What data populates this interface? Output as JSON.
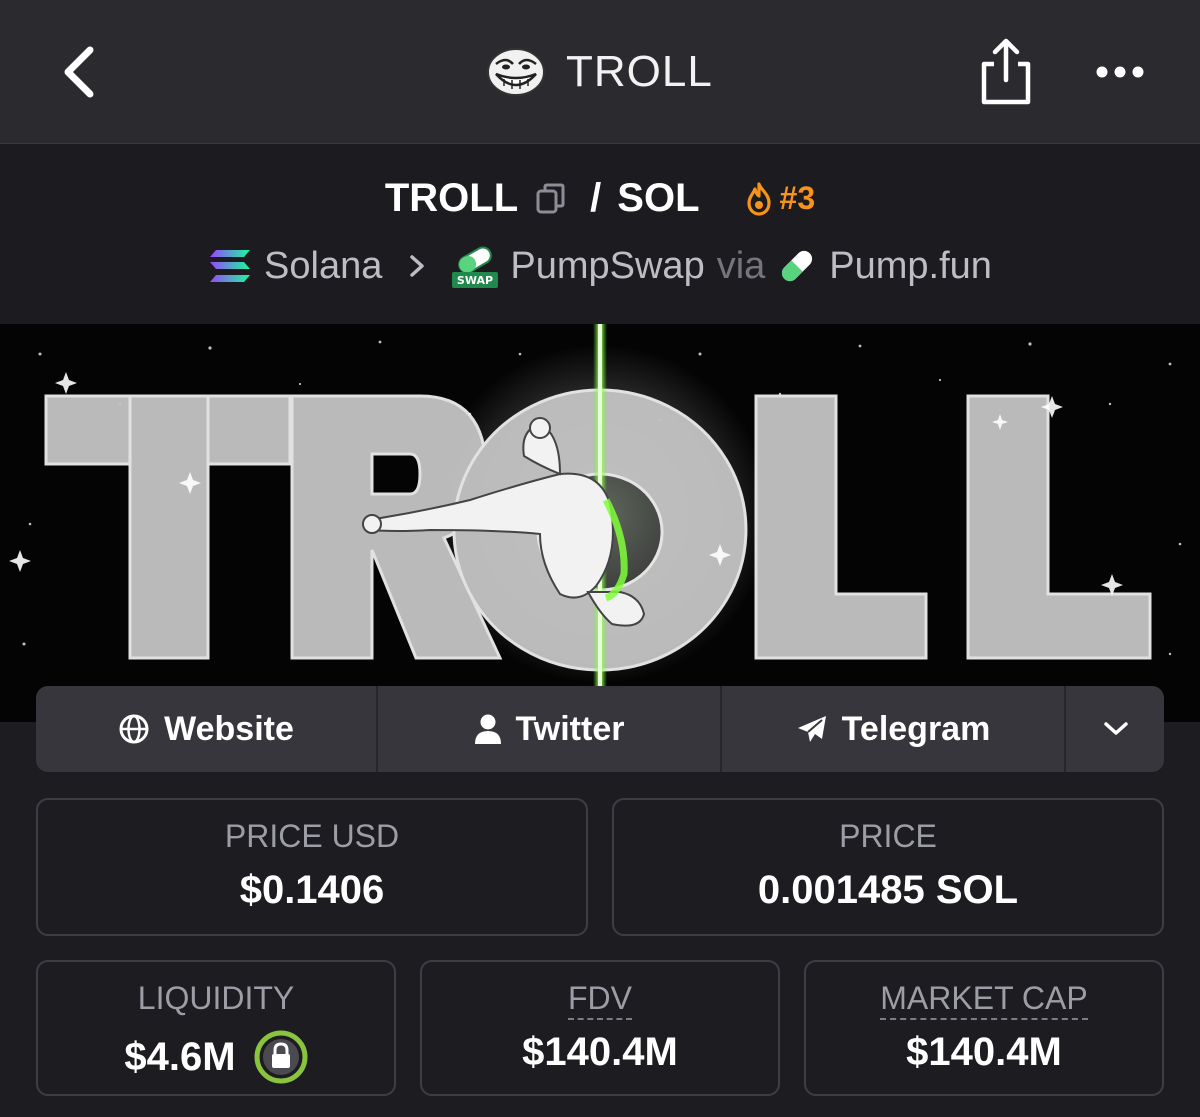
{
  "header": {
    "title": "TROLL",
    "icons": [
      "back-icon",
      "troll-face-icon",
      "share-icon",
      "more-icon"
    ]
  },
  "pair": {
    "base": "TROLL",
    "separator": "/",
    "quote": "SOL",
    "rank": "#3",
    "rank_color": "#f7931a"
  },
  "route": {
    "chain": "Solana",
    "dex": "PumpSwap",
    "via": "via",
    "launchpad": "Pump.fun"
  },
  "banner": {
    "text": "TROLL",
    "glow_color": "#5cff1a"
  },
  "links": {
    "website": "Website",
    "twitter": "Twitter",
    "telegram": "Telegram"
  },
  "stats": {
    "price_usd_label": "PRICE USD",
    "price_usd": "$0.1406",
    "price_label": "PRICE",
    "price": "0.001485 SOL",
    "liquidity_label": "LIQUIDITY",
    "liquidity": "$4.6M",
    "fdv_label": "FDV",
    "fdv": "$140.4M",
    "mcap_label": "MARKET CAP",
    "mcap": "$140.4M",
    "lock_color": "#8ac43f"
  }
}
